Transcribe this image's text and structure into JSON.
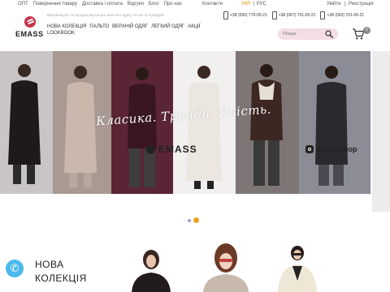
{
  "topbar": {
    "nav": [
      "ОПТ",
      "Повернення товару",
      "Доставка і оплата",
      "Відгуки",
      "Блог",
      "Про нас"
    ],
    "contacts": "Контакти",
    "lang": {
      "active": "УКР",
      "separator": "|",
      "other": "РУС"
    },
    "auth": {
      "login": "Увійти",
      "separator": "|",
      "register": "Реєстрація"
    }
  },
  "logo": {
    "text": "EMASS"
  },
  "tagline": "Виробництво та продаж верхнього жіночого одягу оптом та в роздріб",
  "phones": [
    "+38 (050) 770-00-21",
    "+38 (067) 701-00-21",
    "+38 (093) 701-00-21"
  ],
  "mainnav": [
    "НОВА КОЛЕКЦІЯ",
    "ПАЛЬТО",
    "ВЕРХНІЙ ОДЯГ",
    "ЛЕГКИЙ ОДЯГ",
    "АКЦІЇ",
    "LOOKBOOK"
  ],
  "search": {
    "placeholder": "Пошук"
  },
  "cart": {
    "count": "0"
  },
  "hero": {
    "script": "Класика. Тренди. Якість.",
    "brand": "EMASS",
    "instagram": "emassshop"
  },
  "slider": {
    "total": 2,
    "active": 2
  },
  "section": {
    "title_line1": "НОВА",
    "title_line2": "КОЛЕКЦІЯ"
  },
  "colors": {
    "accent": "#f0a020",
    "search_bg": "#f3dde6",
    "phone_fab": "#4ab8ee",
    "logo": "#c7344a"
  }
}
